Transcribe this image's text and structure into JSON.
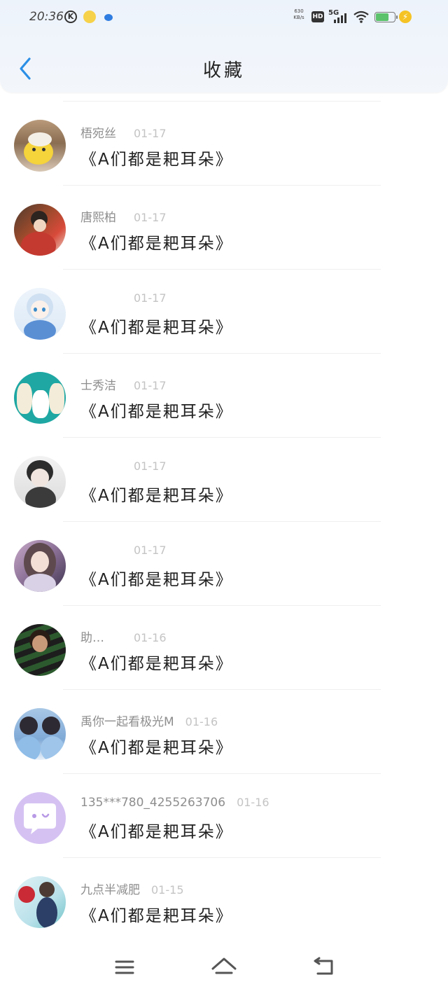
{
  "status_bar": {
    "time": "20:36",
    "net_speed": "630 KB/s",
    "hd": "HD",
    "network": "5G"
  },
  "header": {
    "title": "收藏"
  },
  "items": [
    {
      "name": "梧宛丝",
      "date": "01-17",
      "title": "《A们都是耙耳朵》"
    },
    {
      "name": "唐熙柏",
      "date": "01-17",
      "title": "《A们都是耙耳朵》"
    },
    {
      "name": "",
      "date": "01-17",
      "title": "《A们都是耙耳朵》"
    },
    {
      "name": "士秀洁",
      "date": "01-17",
      "title": "《A们都是耙耳朵》"
    },
    {
      "name": "",
      "date": "01-17",
      "title": "《A们都是耙耳朵》"
    },
    {
      "name": "",
      "date": "01-17",
      "title": "《A们都是耙耳朵》"
    },
    {
      "name": "助…",
      "date": "01-16",
      "title": "《A们都是耙耳朵》"
    },
    {
      "name": "禹你一起看极光M",
      "date": "01-16",
      "title": "《A们都是耙耳朵》"
    },
    {
      "name": "135***780_4255263706",
      "date": "01-16",
      "title": "《A们都是耙耳朵》"
    },
    {
      "name": "九点半减肥",
      "date": "01-15",
      "title": "《A们都是耙耳朵》"
    }
  ],
  "colors": {
    "accent": "#2b8fe6",
    "header_bg": "#eef3fb",
    "date": "#c4c4c4",
    "name": "#8e8e8e"
  }
}
